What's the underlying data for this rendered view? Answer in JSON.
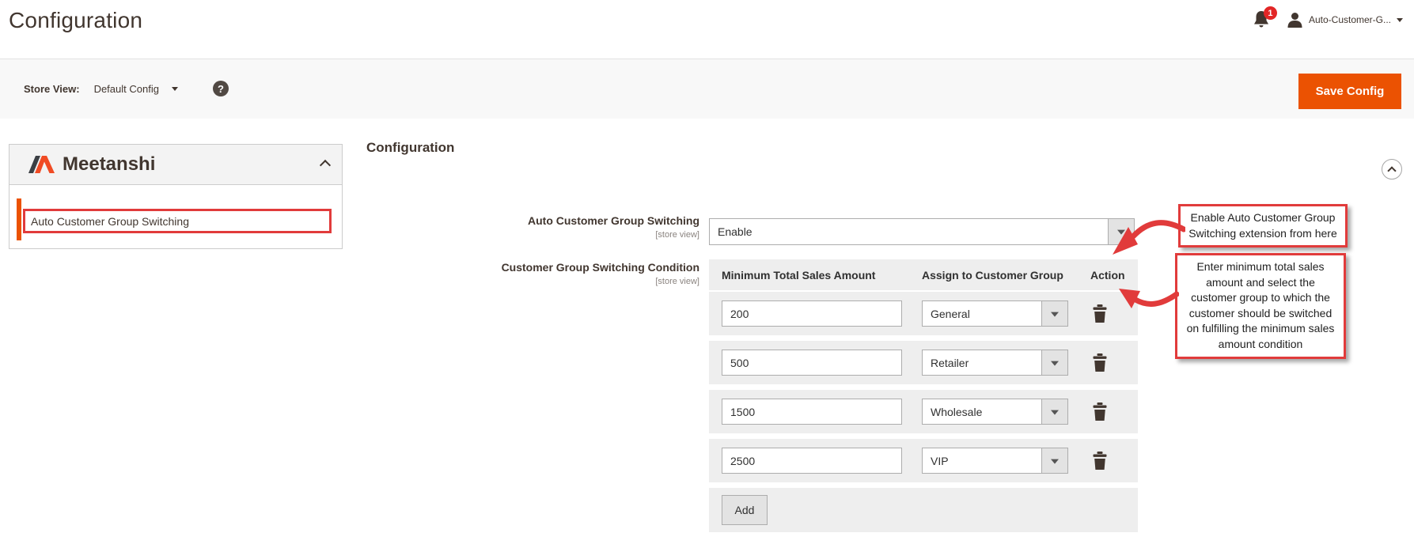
{
  "header": {
    "page_title": "Configuration",
    "notification_count": "1",
    "user_name": "Auto-Customer-G..."
  },
  "toolbar": {
    "store_view_label": "Store View:",
    "store_view_value": "Default Config",
    "help_glyph": "?",
    "save_button": "Save Config"
  },
  "sidebar": {
    "vendor": "Meetanshi",
    "items": [
      {
        "label": "Auto Customer Group Switching",
        "active": true
      }
    ]
  },
  "main": {
    "section_title": "Configuration",
    "field_enable": {
      "label": "Auto Customer Group Switching",
      "scope": "[store view]",
      "value": "Enable"
    },
    "field_condition": {
      "label": "Customer Group Switching Condition",
      "scope": "[store view]"
    },
    "table": {
      "headers": [
        "Minimum Total Sales Amount",
        "Assign to Customer Group",
        "Action"
      ],
      "rows": [
        {
          "amount": "200",
          "group": "General"
        },
        {
          "amount": "500",
          "group": "Retailer"
        },
        {
          "amount": "1500",
          "group": "Wholesale"
        },
        {
          "amount": "2500",
          "group": "VIP"
        }
      ],
      "add_button": "Add"
    }
  },
  "annotations": {
    "callout1": "Enable Auto Customer Group Switching extension from here",
    "callout2": "Enter minimum total sales amount and select the customer group to which the customer should be switched on fulfilling the minimum sales amount condition"
  },
  "icons": {
    "bell": "notification-bell",
    "user": "user-silhouette",
    "help": "question-mark-circle",
    "trash": "trash-can",
    "collapse": "chevron-up-circle"
  },
  "colors": {
    "accent_orange": "#eb5202",
    "annotation_red": "#e13b3b",
    "dark_text": "#41362f",
    "row_gray": "#eeeeee",
    "badge_red": "#e22626"
  }
}
